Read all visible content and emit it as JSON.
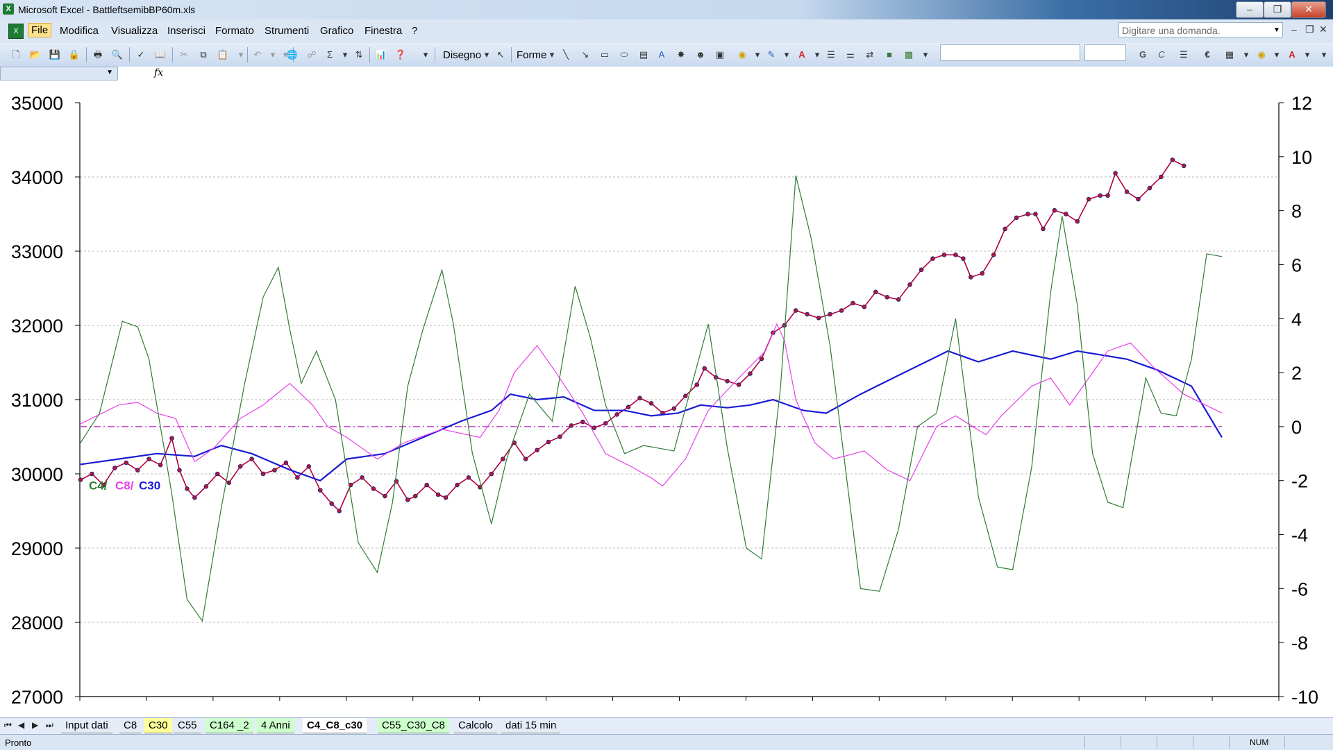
{
  "window": {
    "title": "Microsoft Excel - BattleftsemibBP60m.xls",
    "app_icon": "excel-icon",
    "controls": [
      "minimize",
      "restore",
      "close"
    ]
  },
  "menubar": {
    "items": [
      "File",
      "Modifica",
      "Visualizza",
      "Inserisci",
      "Formato",
      "Strumenti",
      "Grafico",
      "Finestra",
      "?"
    ],
    "active": "File",
    "help_placeholder": "Digitare una domanda."
  },
  "toolbar": {
    "drawing_label": "Disegno",
    "shapes_label": "Forme",
    "bold_label": "G",
    "italic_label": "C",
    "euro_label": "€"
  },
  "formula_bar": {
    "name_box": "",
    "fx_label": "fx"
  },
  "chart": {
    "legend_labels": [
      {
        "text": "C4/",
        "color": "#2e7d32"
      },
      {
        "text": "C8/",
        "color": "#e83fe8"
      },
      {
        "text": "C30",
        "color": "#1a1ad6"
      }
    ]
  },
  "chart_data": {
    "type": "line",
    "y_left": {
      "ticks": [
        "35000",
        "34000",
        "33000",
        "32000",
        "31000",
        "30000",
        "29000",
        "28000",
        "27000"
      ],
      "ylim": [
        27000,
        35000
      ]
    },
    "y_right": {
      "ticks": [
        "12",
        "10",
        "8",
        "6",
        "4",
        "2",
        "0",
        "-2",
        "-4",
        "-6",
        "-8",
        "-10"
      ],
      "ylim": [
        -10,
        12
      ]
    },
    "grid": true,
    "reference_line": {
      "axis": "right",
      "value": 0,
      "color": "#c040c0",
      "style": "dash-dot"
    },
    "series": [
      {
        "axis": "left",
        "color": "#b00040",
        "points": [
          [
            0,
            29920
          ],
          [
            3,
            30000
          ],
          [
            6,
            29850
          ],
          [
            9,
            30080
          ],
          [
            12,
            30150
          ],
          [
            15,
            30050
          ],
          [
            18,
            30200
          ],
          [
            21,
            30120
          ],
          [
            24,
            30480
          ],
          [
            26,
            30050
          ],
          [
            28,
            29800
          ],
          [
            30,
            29680
          ],
          [
            33,
            29830
          ],
          [
            36,
            30000
          ],
          [
            39,
            29880
          ],
          [
            42,
            30100
          ],
          [
            45,
            30200
          ],
          [
            48,
            30000
          ],
          [
            51,
            30050
          ],
          [
            54,
            30150
          ],
          [
            57,
            29950
          ],
          [
            60,
            30100
          ],
          [
            63,
            29780
          ],
          [
            66,
            29600
          ],
          [
            68,
            29500
          ],
          [
            71,
            29850
          ],
          [
            74,
            29950
          ],
          [
            77,
            29800
          ],
          [
            80,
            29700
          ],
          [
            83,
            29900
          ],
          [
            86,
            29650
          ],
          [
            88,
            29700
          ],
          [
            91,
            29850
          ],
          [
            94,
            29720
          ],
          [
            96,
            29680
          ],
          [
            99,
            29850
          ],
          [
            102,
            29950
          ],
          [
            105,
            29820
          ],
          [
            108,
            30000
          ],
          [
            111,
            30200
          ],
          [
            114,
            30420
          ],
          [
            117,
            30200
          ],
          [
            120,
            30320
          ],
          [
            123,
            30430
          ],
          [
            126,
            30500
          ],
          [
            129,
            30650
          ],
          [
            132,
            30700
          ],
          [
            135,
            30620
          ],
          [
            138,
            30680
          ],
          [
            141,
            30800
          ],
          [
            144,
            30900
          ],
          [
            147,
            31020
          ],
          [
            150,
            30950
          ],
          [
            153,
            30820
          ],
          [
            156,
            30880
          ],
          [
            159,
            31050
          ],
          [
            162,
            31200
          ],
          [
            164,
            31420
          ],
          [
            167,
            31300
          ],
          [
            170,
            31250
          ],
          [
            173,
            31200
          ],
          [
            176,
            31350
          ],
          [
            179,
            31550
          ],
          [
            182,
            31900
          ],
          [
            185,
            32000
          ],
          [
            188,
            32200
          ],
          [
            191,
            32150
          ],
          [
            194,
            32100
          ],
          [
            197,
            32150
          ],
          [
            200,
            32200
          ],
          [
            203,
            32300
          ],
          [
            206,
            32250
          ],
          [
            209,
            32450
          ],
          [
            212,
            32380
          ],
          [
            215,
            32350
          ],
          [
            218,
            32550
          ],
          [
            221,
            32750
          ],
          [
            224,
            32900
          ],
          [
            227,
            32950
          ],
          [
            230,
            32950
          ],
          [
            232,
            32900
          ],
          [
            234,
            32650
          ],
          [
            237,
            32700
          ],
          [
            240,
            32950
          ],
          [
            243,
            33300
          ],
          [
            246,
            33450
          ],
          [
            249,
            33500
          ],
          [
            251,
            33500
          ],
          [
            253,
            33300
          ],
          [
            256,
            33550
          ],
          [
            259,
            33500
          ],
          [
            262,
            33400
          ],
          [
            265,
            33700
          ],
          [
            268,
            33750
          ],
          [
            270,
            33750
          ],
          [
            272,
            34050
          ],
          [
            275,
            33800
          ],
          [
            278,
            33700
          ],
          [
            281,
            33850
          ],
          [
            284,
            34000
          ],
          [
            287,
            34230
          ],
          [
            290,
            34150
          ]
        ]
      },
      {
        "axis": "right",
        "color": "#1a1ad6",
        "points": [
          [
            0,
            -1.4
          ],
          [
            10,
            -1.2
          ],
          [
            20,
            -1.0
          ],
          [
            30,
            -1.1
          ],
          [
            37,
            -0.7
          ],
          [
            45,
            -1.0
          ],
          [
            55,
            -1.6
          ],
          [
            63,
            -2.0
          ],
          [
            70,
            -1.2
          ],
          [
            80,
            -1.0
          ],
          [
            90,
            -0.4
          ],
          [
            100,
            0.2
          ],
          [
            108,
            0.6
          ],
          [
            113,
            1.2
          ],
          [
            120,
            1.0
          ],
          [
            127,
            1.1
          ],
          [
            135,
            0.6
          ],
          [
            143,
            0.6
          ],
          [
            150,
            0.4
          ],
          [
            157,
            0.5
          ],
          [
            163,
            0.8
          ],
          [
            170,
            0.7
          ],
          [
            176,
            0.8
          ],
          [
            182,
            1.0
          ],
          [
            190,
            0.6
          ],
          [
            196,
            0.5
          ],
          [
            205,
            1.2
          ],
          [
            215,
            1.9
          ],
          [
            228,
            2.8
          ],
          [
            236,
            2.4
          ],
          [
            245,
            2.8
          ],
          [
            255,
            2.5
          ],
          [
            262,
            2.8
          ],
          [
            275,
            2.5
          ],
          [
            283,
            2.1
          ],
          [
            292,
            1.5
          ],
          [
            300,
            -0.4
          ]
        ]
      },
      {
        "axis": "right",
        "color": "#e83fe8",
        "points": [
          [
            0,
            0.1
          ],
          [
            10,
            0.8
          ],
          [
            15,
            0.9
          ],
          [
            20,
            0.5
          ],
          [
            25,
            0.3
          ],
          [
            30,
            -1.3
          ],
          [
            35,
            -0.8
          ],
          [
            42,
            0.3
          ],
          [
            48,
            0.8
          ],
          [
            55,
            1.6
          ],
          [
            61,
            0.8
          ],
          [
            65,
            0.0
          ],
          [
            70,
            -0.4
          ],
          [
            78,
            -1.2
          ],
          [
            85,
            -0.6
          ],
          [
            95,
            -0.1
          ],
          [
            105,
            -0.4
          ],
          [
            110,
            0.6
          ],
          [
            114,
            2.0
          ],
          [
            120,
            3.0
          ],
          [
            125,
            2.0
          ],
          [
            132,
            0.5
          ],
          [
            138,
            -1.0
          ],
          [
            145,
            -1.5
          ],
          [
            150,
            -1.9
          ],
          [
            153,
            -2.2
          ],
          [
            159,
            -1.2
          ],
          [
            165,
            0.6
          ],
          [
            173,
            1.8
          ],
          [
            180,
            2.8
          ],
          [
            183,
            3.8
          ],
          [
            185,
            3.2
          ],
          [
            188,
            1.0
          ],
          [
            193,
            -0.6
          ],
          [
            198,
            -1.2
          ],
          [
            206,
            -0.9
          ],
          [
            212,
            -1.6
          ],
          [
            218,
            -2.0
          ],
          [
            225,
            0.0
          ],
          [
            230,
            0.4
          ],
          [
            238,
            -0.3
          ],
          [
            242,
            0.4
          ],
          [
            250,
            1.5
          ],
          [
            255,
            1.8
          ],
          [
            260,
            0.8
          ],
          [
            265,
            1.8
          ],
          [
            270,
            2.8
          ],
          [
            276,
            3.1
          ],
          [
            282,
            2.2
          ],
          [
            290,
            1.2
          ],
          [
            300,
            0.5
          ]
        ]
      },
      {
        "axis": "right",
        "color": "#2e7d32",
        "points": [
          [
            0,
            -0.6
          ],
          [
            5,
            0.5
          ],
          [
            11,
            3.9
          ],
          [
            15,
            3.7
          ],
          [
            18,
            2.5
          ],
          [
            24,
            -2.5
          ],
          [
            28,
            -6.4
          ],
          [
            32,
            -7.2
          ],
          [
            37,
            -3.0
          ],
          [
            43,
            1.5
          ],
          [
            48,
            4.8
          ],
          [
            52,
            5.9
          ],
          [
            55,
            3.6
          ],
          [
            58,
            1.6
          ],
          [
            62,
            2.8
          ],
          [
            67,
            1.0
          ],
          [
            73,
            -4.3
          ],
          [
            78,
            -5.4
          ],
          [
            82,
            -2.8
          ],
          [
            86,
            1.5
          ],
          [
            90,
            3.6
          ],
          [
            95,
            5.8
          ],
          [
            98,
            3.8
          ],
          [
            103,
            -1.0
          ],
          [
            108,
            -3.6
          ],
          [
            112,
            -1.2
          ],
          [
            118,
            1.2
          ],
          [
            124,
            0.2
          ],
          [
            130,
            5.2
          ],
          [
            134,
            3.3
          ],
          [
            138,
            0.8
          ],
          [
            143,
            -1.0
          ],
          [
            148,
            -0.7
          ],
          [
            152,
            -0.8
          ],
          [
            156,
            -0.9
          ],
          [
            160,
            1.2
          ],
          [
            165,
            3.8
          ],
          [
            170,
            -0.8
          ],
          [
            175,
            -4.5
          ],
          [
            179,
            -4.9
          ],
          [
            184,
            1.5
          ],
          [
            188,
            9.3
          ],
          [
            192,
            7.0
          ],
          [
            197,
            3.0
          ],
          [
            201,
            -1.5
          ],
          [
            205,
            -6.0
          ],
          [
            210,
            -6.1
          ],
          [
            215,
            -3.8
          ],
          [
            220,
            0.0
          ],
          [
            225,
            0.5
          ],
          [
            230,
            4.0
          ],
          [
            236,
            -2.6
          ],
          [
            241,
            -5.2
          ],
          [
            245,
            -5.3
          ],
          [
            250,
            -1.5
          ],
          [
            255,
            5.0
          ],
          [
            258,
            7.8
          ],
          [
            262,
            4.5
          ],
          [
            266,
            -1.0
          ],
          [
            270,
            -2.8
          ],
          [
            274,
            -3.0
          ],
          [
            280,
            1.8
          ],
          [
            284,
            0.5
          ],
          [
            288,
            0.4
          ],
          [
            292,
            2.5
          ],
          [
            296,
            6.4
          ],
          [
            300,
            6.3
          ]
        ]
      }
    ]
  },
  "sheet_tabs": {
    "tabs": [
      {
        "label": "Input dati",
        "style": "plain"
      },
      {
        "label": "C8",
        "style": "plain"
      },
      {
        "label": "C30",
        "style": "yellow"
      },
      {
        "label": "C55",
        "style": "plain"
      },
      {
        "label": "C164 _2",
        "style": "green"
      },
      {
        "label": "4 Anni",
        "style": "green"
      },
      {
        "label": "C4_C8_c30",
        "style": "active"
      },
      {
        "label": "C55_C30_C8",
        "style": "green"
      },
      {
        "label": "Calcolo",
        "style": "plain"
      },
      {
        "label": "dati 15 min",
        "style": "plain"
      }
    ]
  },
  "statusbar": {
    "status": "Pronto",
    "num": "NUM"
  }
}
